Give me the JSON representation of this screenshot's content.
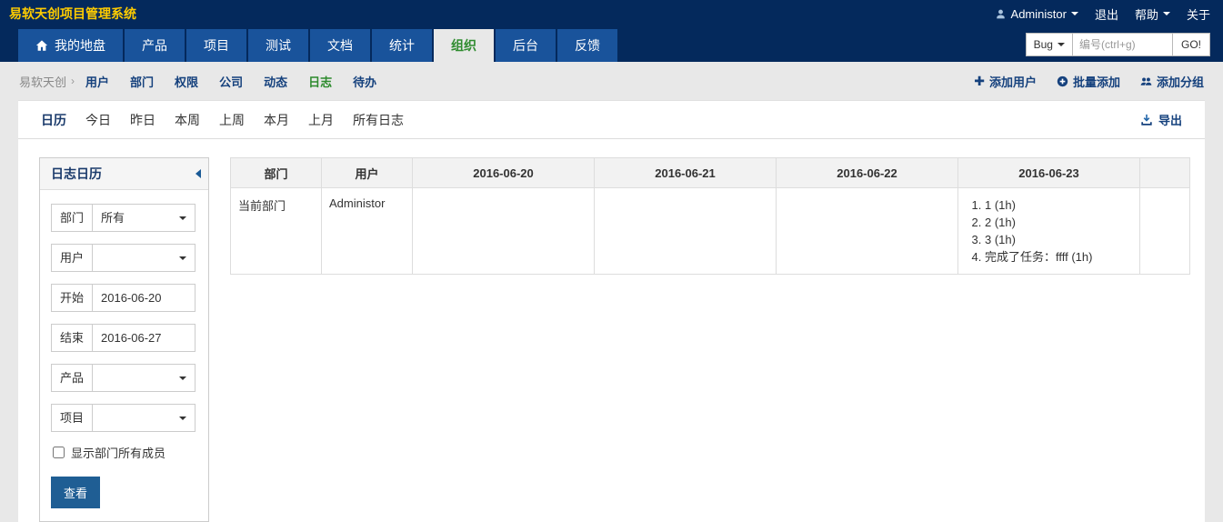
{
  "colors": {
    "header_bg": "#04295c",
    "tab_bg": "#19539b",
    "tab_active_bg": "#e8e8e8",
    "active_green": "#2e8b2e",
    "link_navy": "#15417d",
    "title_yellow": "#ffcc00",
    "button_blue": "#1f5e94",
    "body_bg": "#e8e8e8"
  },
  "app": {
    "title": "易软天创项目管理系统"
  },
  "header": {
    "user": "Administor",
    "logout": "退出",
    "help": "帮助",
    "about": "关于"
  },
  "nav": {
    "tabs": [
      {
        "label": "我的地盘"
      },
      {
        "label": "产品"
      },
      {
        "label": "项目"
      },
      {
        "label": "测试"
      },
      {
        "label": "文档"
      },
      {
        "label": "统计"
      },
      {
        "label": "组织"
      },
      {
        "label": "后台"
      },
      {
        "label": "反馈"
      }
    ],
    "search": {
      "module": "Bug",
      "placeholder": "编号(ctrl+g)",
      "go_label": "GO!"
    }
  },
  "breadcrumb": {
    "root": "易软天创",
    "separator": "›",
    "items": [
      "用户",
      "部门",
      "权限",
      "公司",
      "动态",
      "日志",
      "待办"
    ]
  },
  "actions": {
    "add_user": "添加用户",
    "batch_add": "批量添加",
    "add_group": "添加分组"
  },
  "toolbar": {
    "items": [
      "日历",
      "今日",
      "昨日",
      "本周",
      "上周",
      "本月",
      "上月",
      "所有日志"
    ],
    "export_label": "导出"
  },
  "sidebar": {
    "title": "日志日历",
    "fields": [
      {
        "label": "部门",
        "value": "所有"
      },
      {
        "label": "用户",
        "value": ""
      },
      {
        "label": "开始",
        "value": "2016-06-20"
      },
      {
        "label": "结束",
        "value": "2016-06-27"
      },
      {
        "label": "产品",
        "value": ""
      },
      {
        "label": "项目",
        "value": ""
      }
    ],
    "checkbox_label": "显示部门所有成员",
    "submit_label": "查看"
  },
  "table": {
    "headers": [
      "部门",
      "用户",
      "2016-06-20",
      "2016-06-21",
      "2016-06-22",
      "2016-06-23",
      ""
    ],
    "row": {
      "department": "当前部门",
      "user": "Administor",
      "logs": [
        "1 (1h)",
        "2 (1h)",
        "3 (1h)",
        "完成了任务：ffff (1h)"
      ]
    }
  }
}
